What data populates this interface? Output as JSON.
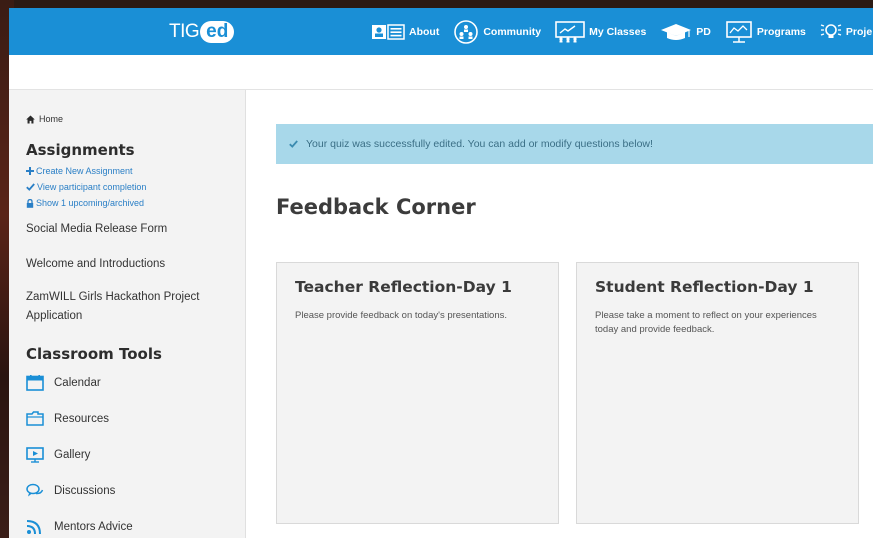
{
  "header": {
    "logo_prefix": "TIG",
    "logo_suffix": "ed",
    "nav": [
      {
        "label": "About",
        "icon": "id-card-icon"
      },
      {
        "label": "Community",
        "icon": "community-icon"
      },
      {
        "label": "My Classes",
        "icon": "classroom-icon"
      },
      {
        "label": "PD",
        "icon": "graduation-cap-icon"
      },
      {
        "label": "Programs",
        "icon": "presentation-icon"
      },
      {
        "label": "Proje",
        "icon": "lightbulb-icon"
      }
    ],
    "color": "#1a8fd6"
  },
  "sidebar": {
    "home": "Home",
    "assignments_heading": "Assignments",
    "links": [
      {
        "label": "Create New Assignment",
        "icon": "plus-icon"
      },
      {
        "label": "View participant completion",
        "icon": "check-icon"
      },
      {
        "label": "Show 1 upcoming/archived",
        "icon": "lock-icon"
      }
    ],
    "items": [
      "Social Media Release Form",
      "Welcome and Introductions",
      "ZamWILL Girls Hackathon Project Application"
    ],
    "tools_heading": "Classroom Tools",
    "tools": [
      {
        "label": "Calendar",
        "icon": "calendar-icon"
      },
      {
        "label": "Resources",
        "icon": "folder-icon"
      },
      {
        "label": "Gallery",
        "icon": "gallery-icon"
      },
      {
        "label": "Discussions",
        "icon": "discussion-icon"
      },
      {
        "label": "Mentors Advice",
        "icon": "rss-icon"
      }
    ]
  },
  "main": {
    "alert": "Your quiz was successfully edited. You can add or modify questions below!",
    "title": "Feedback Corner",
    "cards": [
      {
        "title": "Teacher Reflection-Day 1",
        "description": "Please provide feedback on today's presentations."
      },
      {
        "title": "Student Reflection-Day 1",
        "description": "Please take a moment to reflect on your experiences today and provide feedback."
      }
    ]
  },
  "colors": {
    "accent": "#1a8fd6",
    "link": "#2a7fc6",
    "alert_bg": "#a8d8ea"
  }
}
